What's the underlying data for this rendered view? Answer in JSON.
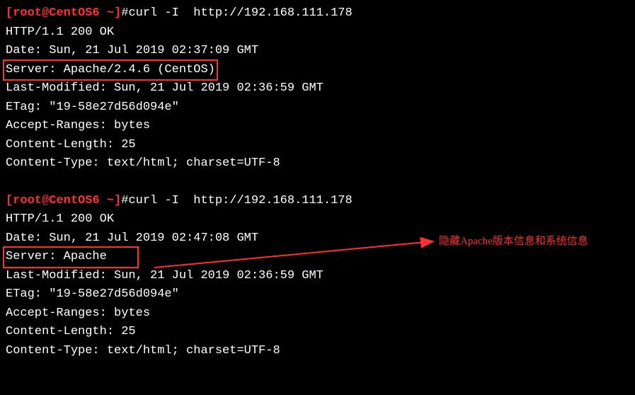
{
  "blocks": [
    {
      "prompt": {
        "host": "[root@CentOS6 ~]",
        "hash": "#",
        "command": "curl -I  http://192.168.111.178"
      },
      "lines": [
        "HTTP/1.1 200 OK",
        "Date: Sun, 21 Jul 2019 02:37:09 GMT"
      ],
      "boxed": "Server: Apache/2.4.6 (CentOS)",
      "after": [
        "Last-Modified: Sun, 21 Jul 2019 02:36:59 GMT",
        "ETag: \"19-58e27d56d094e\"",
        "Accept-Ranges: bytes",
        "Content-Length: 25",
        "Content-Type: text/html; charset=UTF-8"
      ]
    },
    {
      "prompt": {
        "host": "[root@CentOS6 ~]",
        "hash": "#",
        "command": "curl -I  http://192.168.111.178"
      },
      "lines": [
        "HTTP/1.1 200 OK",
        "Date: Sun, 21 Jul 2019 02:47:08 GMT"
      ],
      "boxed": "Server: Apache",
      "after": [
        "Last-Modified: Sun, 21 Jul 2019 02:36:59 GMT",
        "ETag: \"19-58e27d56d094e\"",
        "Accept-Ranges: bytes",
        "Content-Length: 25",
        "Content-Type: text/html; charset=UTF-8"
      ]
    }
  ],
  "annotation": "隐藏Apache版本信息和系统信息"
}
